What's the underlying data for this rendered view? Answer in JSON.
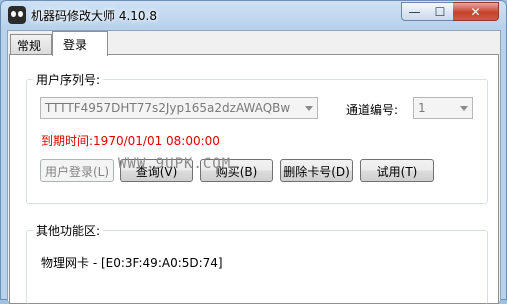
{
  "window": {
    "title": "机器码修改大师 4.10.8",
    "min_glyph": "—",
    "max_glyph": "☐",
    "close_glyph": "✕"
  },
  "tabs": [
    {
      "label": "常规",
      "active": false
    },
    {
      "label": "登录",
      "active": true
    }
  ],
  "user_group": {
    "legend": "用户序列号:",
    "serial_value": "TTTTF4957DHT77s2Jyp165a2dzAWAQBw",
    "channel_label": "通道编号:",
    "channel_value": "1",
    "expire_text": "到期时间:1970/01/01 08:00:00",
    "buttons": {
      "login": "用户登录(L)",
      "query": "查询(V)",
      "buy": "购买(B)",
      "delete": "删除卡号(D)",
      "trial": "试用(T)"
    }
  },
  "other_group": {
    "legend": "其他功能区:",
    "nic_text": "物理网卡 - [E0:3F:49:A0:5D:74]"
  },
  "watermark": "WWW.9UPK.COM",
  "colors": {
    "expire_text": "#e00000",
    "title_bar": "#b9d2ec",
    "close_button": "#c7422b"
  }
}
